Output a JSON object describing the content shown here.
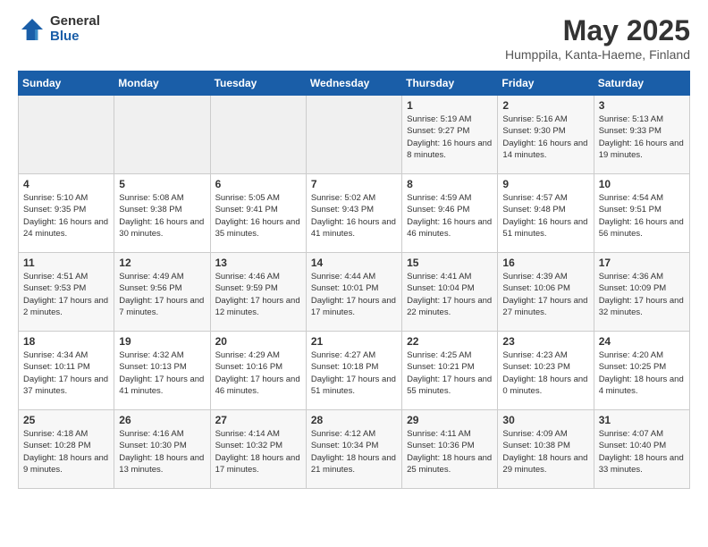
{
  "header": {
    "logo_general": "General",
    "logo_blue": "Blue",
    "title": "May 2025",
    "location": "Humppila, Kanta-Haeme, Finland"
  },
  "days_of_week": [
    "Sunday",
    "Monday",
    "Tuesday",
    "Wednesday",
    "Thursday",
    "Friday",
    "Saturday"
  ],
  "weeks": [
    [
      {
        "day": "",
        "info": ""
      },
      {
        "day": "",
        "info": ""
      },
      {
        "day": "",
        "info": ""
      },
      {
        "day": "",
        "info": ""
      },
      {
        "day": "1",
        "info": "Sunrise: 5:19 AM\nSunset: 9:27 PM\nDaylight: 16 hours\nand 8 minutes."
      },
      {
        "day": "2",
        "info": "Sunrise: 5:16 AM\nSunset: 9:30 PM\nDaylight: 16 hours\nand 14 minutes."
      },
      {
        "day": "3",
        "info": "Sunrise: 5:13 AM\nSunset: 9:33 PM\nDaylight: 16 hours\nand 19 minutes."
      }
    ],
    [
      {
        "day": "4",
        "info": "Sunrise: 5:10 AM\nSunset: 9:35 PM\nDaylight: 16 hours\nand 24 minutes."
      },
      {
        "day": "5",
        "info": "Sunrise: 5:08 AM\nSunset: 9:38 PM\nDaylight: 16 hours\nand 30 minutes."
      },
      {
        "day": "6",
        "info": "Sunrise: 5:05 AM\nSunset: 9:41 PM\nDaylight: 16 hours\nand 35 minutes."
      },
      {
        "day": "7",
        "info": "Sunrise: 5:02 AM\nSunset: 9:43 PM\nDaylight: 16 hours\nand 41 minutes."
      },
      {
        "day": "8",
        "info": "Sunrise: 4:59 AM\nSunset: 9:46 PM\nDaylight: 16 hours\nand 46 minutes."
      },
      {
        "day": "9",
        "info": "Sunrise: 4:57 AM\nSunset: 9:48 PM\nDaylight: 16 hours\nand 51 minutes."
      },
      {
        "day": "10",
        "info": "Sunrise: 4:54 AM\nSunset: 9:51 PM\nDaylight: 16 hours\nand 56 minutes."
      }
    ],
    [
      {
        "day": "11",
        "info": "Sunrise: 4:51 AM\nSunset: 9:53 PM\nDaylight: 17 hours\nand 2 minutes."
      },
      {
        "day": "12",
        "info": "Sunrise: 4:49 AM\nSunset: 9:56 PM\nDaylight: 17 hours\nand 7 minutes."
      },
      {
        "day": "13",
        "info": "Sunrise: 4:46 AM\nSunset: 9:59 PM\nDaylight: 17 hours\nand 12 minutes."
      },
      {
        "day": "14",
        "info": "Sunrise: 4:44 AM\nSunset: 10:01 PM\nDaylight: 17 hours\nand 17 minutes."
      },
      {
        "day": "15",
        "info": "Sunrise: 4:41 AM\nSunset: 10:04 PM\nDaylight: 17 hours\nand 22 minutes."
      },
      {
        "day": "16",
        "info": "Sunrise: 4:39 AM\nSunset: 10:06 PM\nDaylight: 17 hours\nand 27 minutes."
      },
      {
        "day": "17",
        "info": "Sunrise: 4:36 AM\nSunset: 10:09 PM\nDaylight: 17 hours\nand 32 minutes."
      }
    ],
    [
      {
        "day": "18",
        "info": "Sunrise: 4:34 AM\nSunset: 10:11 PM\nDaylight: 17 hours\nand 37 minutes."
      },
      {
        "day": "19",
        "info": "Sunrise: 4:32 AM\nSunset: 10:13 PM\nDaylight: 17 hours\nand 41 minutes."
      },
      {
        "day": "20",
        "info": "Sunrise: 4:29 AM\nSunset: 10:16 PM\nDaylight: 17 hours\nand 46 minutes."
      },
      {
        "day": "21",
        "info": "Sunrise: 4:27 AM\nSunset: 10:18 PM\nDaylight: 17 hours\nand 51 minutes."
      },
      {
        "day": "22",
        "info": "Sunrise: 4:25 AM\nSunset: 10:21 PM\nDaylight: 17 hours\nand 55 minutes."
      },
      {
        "day": "23",
        "info": "Sunrise: 4:23 AM\nSunset: 10:23 PM\nDaylight: 18 hours\nand 0 minutes."
      },
      {
        "day": "24",
        "info": "Sunrise: 4:20 AM\nSunset: 10:25 PM\nDaylight: 18 hours\nand 4 minutes."
      }
    ],
    [
      {
        "day": "25",
        "info": "Sunrise: 4:18 AM\nSunset: 10:28 PM\nDaylight: 18 hours\nand 9 minutes."
      },
      {
        "day": "26",
        "info": "Sunrise: 4:16 AM\nSunset: 10:30 PM\nDaylight: 18 hours\nand 13 minutes."
      },
      {
        "day": "27",
        "info": "Sunrise: 4:14 AM\nSunset: 10:32 PM\nDaylight: 18 hours\nand 17 minutes."
      },
      {
        "day": "28",
        "info": "Sunrise: 4:12 AM\nSunset: 10:34 PM\nDaylight: 18 hours\nand 21 minutes."
      },
      {
        "day": "29",
        "info": "Sunrise: 4:11 AM\nSunset: 10:36 PM\nDaylight: 18 hours\nand 25 minutes."
      },
      {
        "day": "30",
        "info": "Sunrise: 4:09 AM\nSunset: 10:38 PM\nDaylight: 18 hours\nand 29 minutes."
      },
      {
        "day": "31",
        "info": "Sunrise: 4:07 AM\nSunset: 10:40 PM\nDaylight: 18 hours\nand 33 minutes."
      }
    ]
  ]
}
